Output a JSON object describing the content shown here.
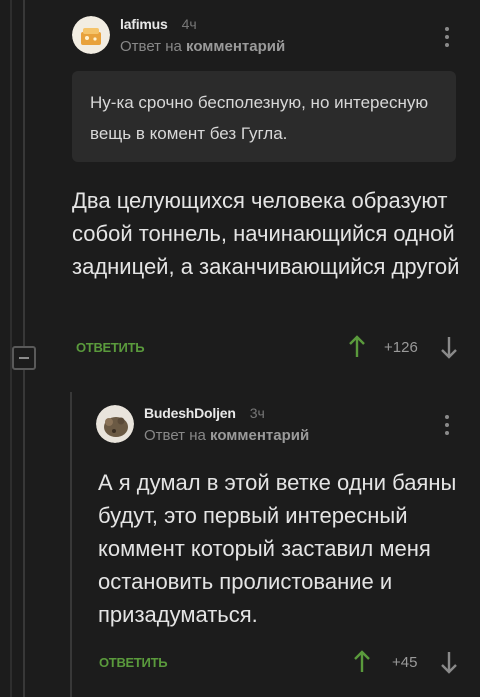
{
  "comment1": {
    "author": "lafimus",
    "time": "4ч",
    "reply_prefix": "Ответ на",
    "reply_target": "комментарий",
    "quote": "Ну-ка срочно бесполезную, но интересную вещь в комент без Гугла.",
    "text": "Два целующихся человека образуют собой тоннель, начинающийся одной задницей, а заканчивающийся другой",
    "reply_label": "ОТВЕТИТЬ",
    "score": "+126"
  },
  "comment2": {
    "author": "BudeshDoljen",
    "time": "3ч",
    "reply_prefix": "Ответ на",
    "reply_target": "комментарий",
    "text": "А я думал в этой ветке одни баяны будут, это первый интересный коммент который заставил меня остановить пролистование и призадуматься.",
    "reply_label": "ОТВЕТИТЬ",
    "score": "+45"
  },
  "colors": {
    "background": "#1c1c1c",
    "quote_bg": "#2b2b2b",
    "reply_green": "#5a9a3c",
    "arrow_up": "#5a9a3c"
  }
}
